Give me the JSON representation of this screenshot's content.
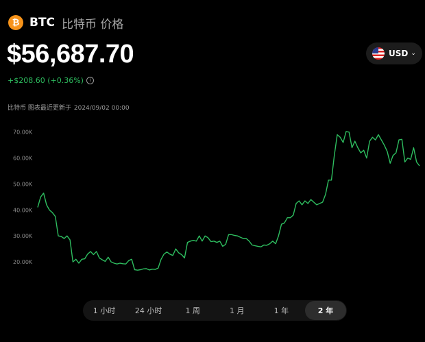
{
  "header": {
    "icon_glyph": "₿",
    "symbol": "BTC",
    "name": "比特币 价格"
  },
  "price": "$56,687.70",
  "change": "+$208.60 (+0.36%)",
  "info_glyph": "i",
  "currency": {
    "label": "USD",
    "chevron": "⌄",
    "icon": "us-flag-icon"
  },
  "updated": {
    "prefix": "比特币 图表最近更新于",
    "time": "2024/09/02 00:00"
  },
  "ranges": [
    {
      "label": "1 小时",
      "active": false
    },
    {
      "label": "24 小时",
      "active": false
    },
    {
      "label": "1 周",
      "active": false
    },
    {
      "label": "1 月",
      "active": false
    },
    {
      "label": "1 年",
      "active": false
    },
    {
      "label": "2 年",
      "active": true
    }
  ],
  "colors": {
    "line": "#2ebd5f",
    "accent": "#f7931a",
    "background": "#000000"
  },
  "chart_data": {
    "type": "line",
    "ylim": [
      10000,
      76000
    ],
    "yticks": [
      20000,
      30000,
      40000,
      50000,
      60000,
      70000
    ],
    "ytick_labels": [
      "20.00K",
      "30.00K",
      "40.00K",
      "50.00K",
      "60.00K",
      "70.00K"
    ],
    "grid": false,
    "series": [
      {
        "values": [
          41000,
          45000,
          46500,
          42000,
          40000,
          39000,
          37500,
          30000,
          29800,
          29000,
          30000,
          28500,
          20000,
          21000,
          19500,
          21000,
          21200,
          23000,
          24000,
          22800,
          24000,
          21500,
          20800,
          20200,
          21800,
          20000,
          19500,
          19200,
          19500,
          19300,
          19200,
          20500,
          21000,
          17000,
          16800,
          17000,
          17300,
          17400,
          16900,
          17200,
          17100,
          17600,
          21000,
          23000,
          23800,
          23000,
          22500,
          25000,
          23500,
          22800,
          21500,
          27500,
          28000,
          28300,
          28000,
          30000,
          28000,
          30000,
          29300,
          27800,
          28000,
          27500,
          28000,
          26000,
          26800,
          30500,
          30500,
          30200,
          30000,
          29500,
          29000,
          29000,
          28000,
          26500,
          26200,
          26000,
          25800,
          26500,
          26400,
          27000,
          28000,
          27000,
          30000,
          34500,
          35000,
          37000,
          37000,
          38000,
          42500,
          43500,
          42000,
          43500,
          42500,
          44000,
          43000,
          42000,
          42500,
          43000,
          46000,
          51500,
          51500,
          61000,
          69000,
          68000,
          66000,
          70200,
          70000,
          64000,
          66500,
          64000,
          62000,
          63000,
          60000,
          66500,
          68000,
          67000,
          69000,
          67000,
          65000,
          62500,
          58000,
          61000,
          62000,
          67000,
          67200,
          58500,
          60000,
          59500,
          64000,
          58500,
          57000
        ]
      }
    ]
  }
}
